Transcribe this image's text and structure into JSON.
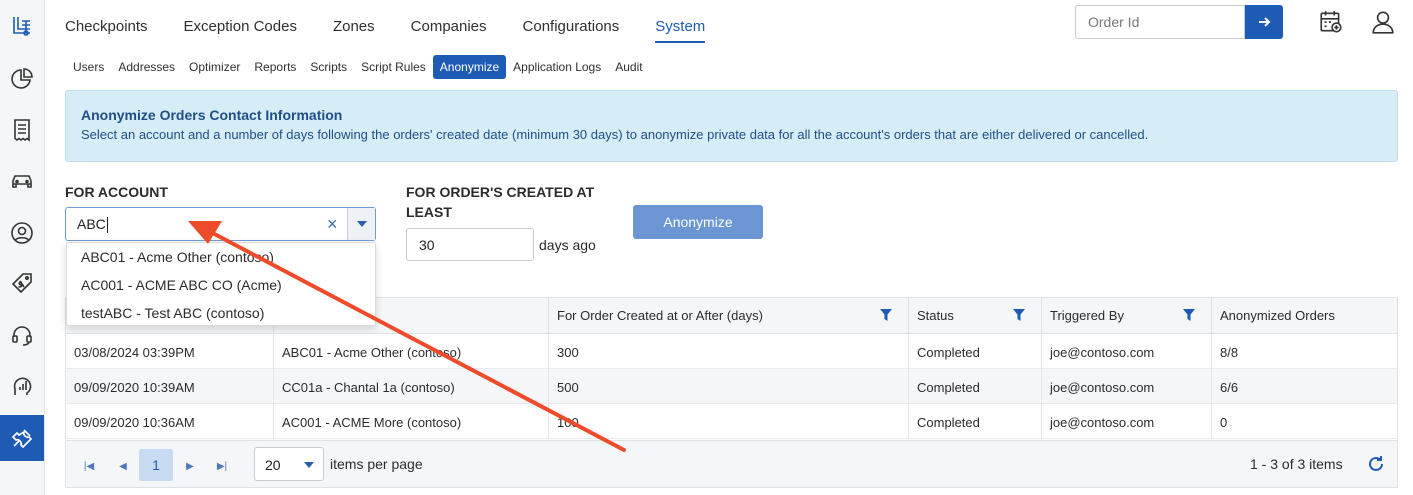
{
  "colors": {
    "accent": "#1e5bb5",
    "annotation_arrow": "#ee4b2b",
    "info_bg": "#d6ecf6"
  },
  "sidebar": {
    "items": [
      {
        "icon": "logo-icon"
      },
      {
        "icon": "pie-chart-icon"
      },
      {
        "icon": "receipt-icon"
      },
      {
        "icon": "car-icon"
      },
      {
        "icon": "user-circle-icon"
      },
      {
        "icon": "price-tag-icon"
      },
      {
        "icon": "headset-icon"
      },
      {
        "icon": "analytics-icon"
      },
      {
        "icon": "tools-icon",
        "active": true
      }
    ]
  },
  "nav": {
    "tabs": [
      "Checkpoints",
      "Exception Codes",
      "Zones",
      "Companies",
      "Configurations",
      "System"
    ],
    "active": "System"
  },
  "header": {
    "order_placeholder": "Order Id"
  },
  "subnav": {
    "items": [
      "Users",
      "Addresses",
      "Optimizer",
      "Reports",
      "Scripts",
      "Script Rules",
      "Anonymize",
      "Application Logs",
      "Audit"
    ],
    "active": "Anonymize"
  },
  "info": {
    "title": "Anonymize Orders Contact Information",
    "text": "Select an account and a number of days following the orders' created date (minimum 30 days) to anonymize private data for all the account's orders that are either delivered or cancelled."
  },
  "form": {
    "account_label": "FOR ACCOUNT",
    "account_value": "ABC",
    "days_label_line1": "FOR ORDER'S CREATED AT",
    "days_label_line2": "LEAST",
    "days_value": "30",
    "days_suffix": "days ago",
    "button": "Anonymize"
  },
  "dropdown": {
    "options": [
      "ABC01 - Acme Other (contoso)",
      "AC001 - ACME ABC CO (Acme)",
      "testABC - Test ABC (contoso)"
    ]
  },
  "grid": {
    "columns": [
      "",
      "",
      "For Order Created at or After (days)",
      "Status",
      "Triggered By",
      "Anonymized Orders"
    ],
    "rows": [
      [
        "03/08/2024 03:39PM",
        "ABC01 - Acme Other (contoso)",
        "300",
        "Completed",
        "joe@contoso.com",
        "8/8"
      ],
      [
        "09/09/2020 10:39AM",
        "CC01a - Chantal 1a (contoso)",
        "500",
        "Completed",
        "joe@contoso.com",
        "6/6"
      ],
      [
        "09/09/2020 10:36AM",
        "AC001 - ACME More (contoso)",
        "100",
        "Completed",
        "joe@contoso.com",
        "0"
      ]
    ]
  },
  "pager": {
    "current_page": "1",
    "page_size": "20",
    "size_label": "items per page",
    "info": "1 - 3 of 3 items"
  }
}
